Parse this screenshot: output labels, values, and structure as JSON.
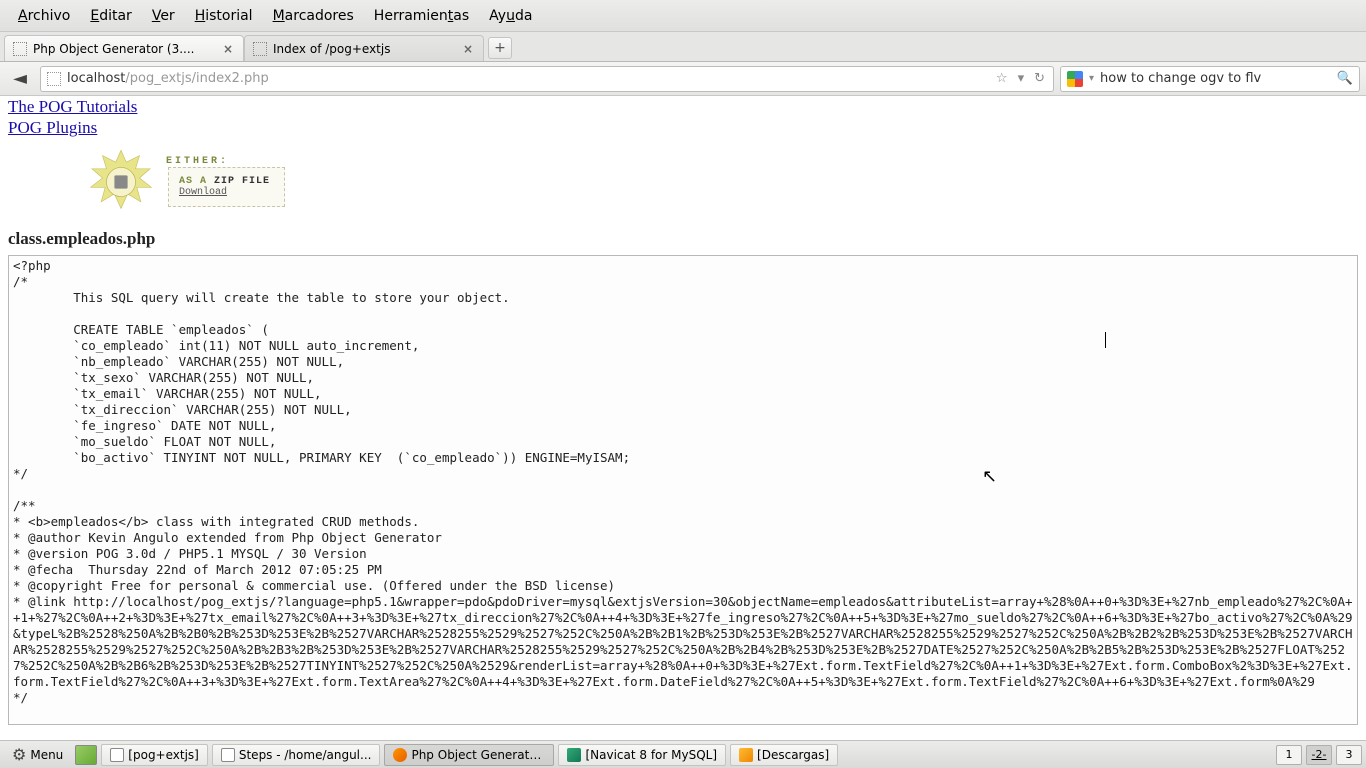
{
  "menubar": {
    "archivo": "Archivo",
    "editar": "Editar",
    "ver": "Ver",
    "historial": "Historial",
    "marcadores": "Marcadores",
    "herramientas": "Herramientas",
    "ayuda": "Ayuda"
  },
  "tabs": {
    "tab1": "Php Object Generator (3....",
    "tab2": "Index of /pog+extjs"
  },
  "url": {
    "host": "localhost",
    "path": "/pog_extjs/index2.php"
  },
  "search": {
    "query": "how to change ogv to flv"
  },
  "links": {
    "tutorials": "The POG Tutorials",
    "plugins": "POG Plugins"
  },
  "either": {
    "title": "EITHER:",
    "asa": "AS A ",
    "zip": "ZIP FILE",
    "download": "Download"
  },
  "classfile": "class.empleados.php",
  "code": {
    "l1": "<?php",
    "l2": "/*",
    "l3": "        This SQL query will create the table to store your object.",
    "l4": "",
    "l5": "        CREATE TABLE `empleados` (",
    "l6": "        `co_empleado` int(11) NOT NULL auto_increment,",
    "l7": "        `nb_empleado` VARCHAR(255) NOT NULL,",
    "l8": "        `tx_sexo` VARCHAR(255) NOT NULL,",
    "l9": "        `tx_email` VARCHAR(255) NOT NULL,",
    "l10": "        `tx_direccion` VARCHAR(255) NOT NULL,",
    "l11": "        `fe_ingreso` DATE NOT NULL,",
    "l12": "        `mo_sueldo` FLOAT NOT NULL,",
    "l13": "        `bo_activo` TINYINT NOT NULL, PRIMARY KEY  (`co_empleado`)) ENGINE=MyISAM;",
    "l14": "*/",
    "l15": "",
    "l16": "/**",
    "l17": "* <b>empleados</b> class with integrated CRUD methods.",
    "l18": "* @author Kevin Angulo extended from Php Object Generator",
    "l19": "* @version POG 3.0d / PHP5.1 MYSQL / 30 Version",
    "l20": "* @fecha  Thursday 22nd of March 2012 07:05:25 PM",
    "l21": "* @copyright Free for personal & commercial use. (Offered under the BSD license)",
    "l22": "* @link http://localhost/pog_extjs/?language=php5.1&wrapper=pdo&pdoDriver=mysql&extjsVersion=30&objectName=empleados&attributeList=array+%28%0A++0+%3D%3E+%27nb_empleado%27%2C%0A++1+%27%2C%0A++2+%3D%3E+%27tx_email%27%2C%0A++3+%3D%3E+%27tx_direccion%27%2C%0A++4+%3D%3E+%27fe_ingreso%27%2C%0A++5+%3D%3E+%27mo_sueldo%27%2C%0A++6+%3D%3E+%27bo_activo%27%2C%0A%29&typeL%2B%2528%250A%2B%2B0%2B%253D%253E%2B%2527VARCHAR%2528255%2529%2527%252C%250A%2B%2B1%2B%253D%253E%2B%2527VARCHAR%2528255%2529%2527%252C%250A%2B%2B2%2B%253D%253E%2B%2527VARCHAR%2528255%2529%2527%252C%250A%2B%2B3%2B%253D%253E%2B%2527VARCHAR%2528255%2529%2527%252C%250A%2B%2B4%2B%253D%253E%2B%2527DATE%2527%252C%250A%2B%2B5%2B%253D%253E%2B%2527FLOAT%2527%252C%250A%2B%2B6%2B%253D%253E%2B%2527TINYINT%2527%252C%250A%2529&renderList=array+%28%0A++0+%3D%3E+%27Ext.form.TextField%27%2C%0A++1+%3D%3E+%27Ext.form.ComboBox%2%3D%3E+%27Ext.form.TextField%27%2C%0A++3+%3D%3E+%27Ext.form.TextArea%27%2C%0A++4+%3D%3E+%27Ext.form.DateField%27%2C%0A++5+%3D%3E+%27Ext.form.TextField%27%2C%0A++6+%3D%3E+%27Ext.form%0A%29",
    "l23": "*/"
  },
  "taskbar": {
    "menu": "Menu",
    "t1": "[pog+extjs]",
    "t2": "Steps - /home/angul...",
    "t3": "Php Object Generato...",
    "t4": "[Navicat 8 for MySQL]",
    "t5": "[Descargas]",
    "ws1": "1",
    "ws2": "2",
    "ws3": "3"
  }
}
